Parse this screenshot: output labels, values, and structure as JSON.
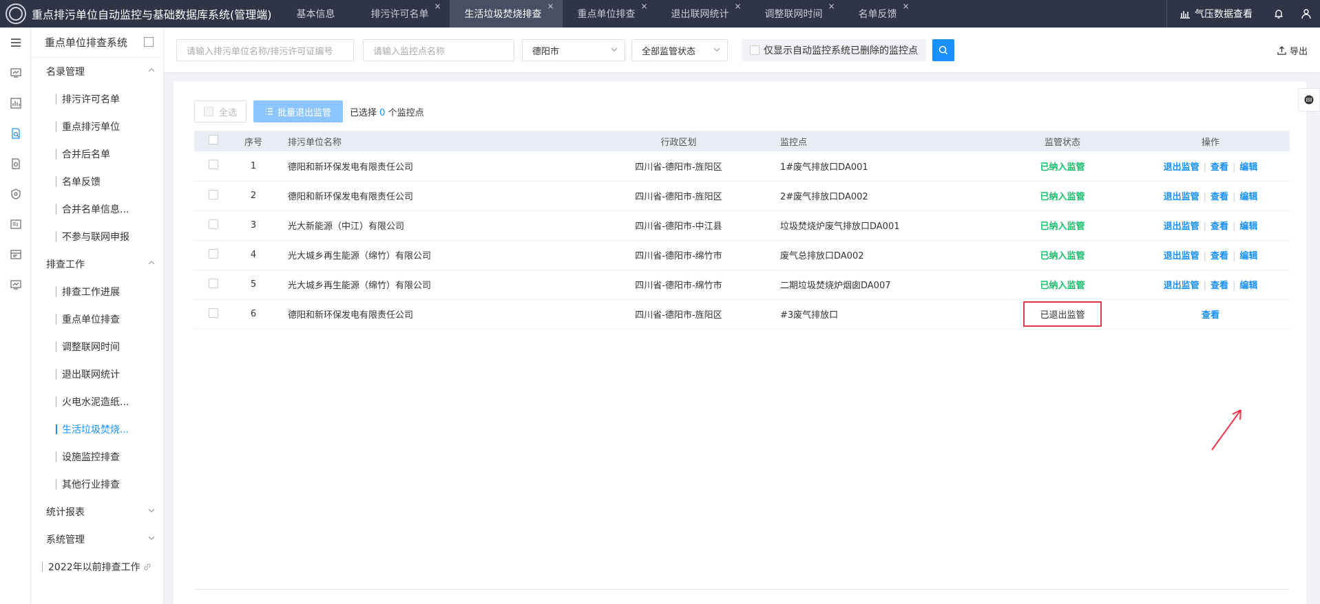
{
  "app": {
    "title": "重点排污单位自动监控与基础数据库系统(管理端)"
  },
  "tabs": [
    {
      "label": "基本信息",
      "closable": false,
      "active": false
    },
    {
      "label": "排污许可名单",
      "closable": true,
      "active": false
    },
    {
      "label": "生活垃圾焚烧排查",
      "closable": true,
      "active": true
    },
    {
      "label": "重点单位排查",
      "closable": true,
      "active": false
    },
    {
      "label": "退出联网统计",
      "closable": true,
      "active": false
    },
    {
      "label": "调整联网时间",
      "closable": true,
      "active": false
    },
    {
      "label": "名单反馈",
      "closable": true,
      "active": false
    }
  ],
  "tab_close_glyph": "×",
  "topright": {
    "pressure_link": "气压数据查看",
    "icons": [
      "chart-icon",
      "bell-icon",
      "user-icon"
    ]
  },
  "sidebar": {
    "title": "重点单位排查系统",
    "groups": [
      {
        "label": "名录管理",
        "expanded": true,
        "items": [
          "排污许可名单",
          "重点排污单位",
          "合并后名单",
          "名单反馈",
          "合并名单信息...",
          "不参与联网申报"
        ]
      },
      {
        "label": "排查工作",
        "expanded": true,
        "items": [
          "排查工作进展",
          "重点单位排查",
          "调整联网时间",
          "退出联网统计",
          "火电水泥造纸...",
          "生活垃圾焚烧...",
          "设施监控排查",
          "其他行业排查"
        ]
      },
      {
        "label": "统计报表",
        "expanded": false,
        "items": []
      },
      {
        "label": "系统管理",
        "expanded": false,
        "items": []
      }
    ],
    "active_item": "生活垃圾焚烧...",
    "extra_link": "2022年以前排查工作"
  },
  "filters": {
    "unit_placeholder": "请输入排污单位名称/排污许可证编号",
    "point_placeholder": "请输入监控点名称",
    "city_value": "德阳市",
    "status_value": "全部监管状态",
    "deleted_only_label": "仅显示自动监控系统已删除的监控点",
    "export_label": "导出"
  },
  "toolbar": {
    "select_all": "全选",
    "batch_exit": "批量退出监管",
    "selected_prefix": "已选择",
    "selected_count": "0",
    "selected_suffix": "个监控点"
  },
  "table": {
    "columns": [
      "序号",
      "排污单位名称",
      "行政区划",
      "监控点",
      "监管状态",
      "操作"
    ],
    "rows": [
      {
        "idx": "1",
        "name": "德阳和新环保发电有限责任公司",
        "region": "四川省-德阳市-旌阳区",
        "point": "1#废气排放口DA001",
        "status": "已纳入监管",
        "ops": [
          "退出监管",
          "查看",
          "编辑"
        ]
      },
      {
        "idx": "2",
        "name": "德阳和新环保发电有限责任公司",
        "region": "四川省-德阳市-旌阳区",
        "point": "2#废气排放口DA002",
        "status": "已纳入监管",
        "ops": [
          "退出监管",
          "查看",
          "编辑"
        ]
      },
      {
        "idx": "3",
        "name": "光大新能源（中江）有限公司",
        "region": "四川省-德阳市-中江县",
        "point": "垃圾焚烧炉废气排放口DA001",
        "status": "已纳入监管",
        "ops": [
          "退出监管",
          "查看",
          "编辑"
        ]
      },
      {
        "idx": "4",
        "name": "光大城乡再生能源（绵竹）有限公司",
        "region": "四川省-德阳市-绵竹市",
        "point": "废气总排放口DA002",
        "status": "已纳入监管",
        "ops": [
          "退出监管",
          "查看",
          "编辑"
        ]
      },
      {
        "idx": "5",
        "name": "光大城乡再生能源（绵竹）有限公司",
        "region": "四川省-德阳市-绵竹市",
        "point": "二期垃圾焚烧炉烟囱DA007",
        "status": "已纳入监管",
        "ops": [
          "退出监管",
          "查看",
          "编辑"
        ]
      },
      {
        "idx": "6",
        "name": "德阳和新环保发电有限责任公司",
        "region": "四川省-德阳市-旌阳区",
        "point": "#3废气排放口",
        "status": "已退出监管",
        "ops": [
          "查看"
        ]
      }
    ]
  },
  "colors": {
    "accent": "#1890ff",
    "topbar": "#2f3447",
    "ok": "#19be6b",
    "highlight": "#e8334a"
  }
}
